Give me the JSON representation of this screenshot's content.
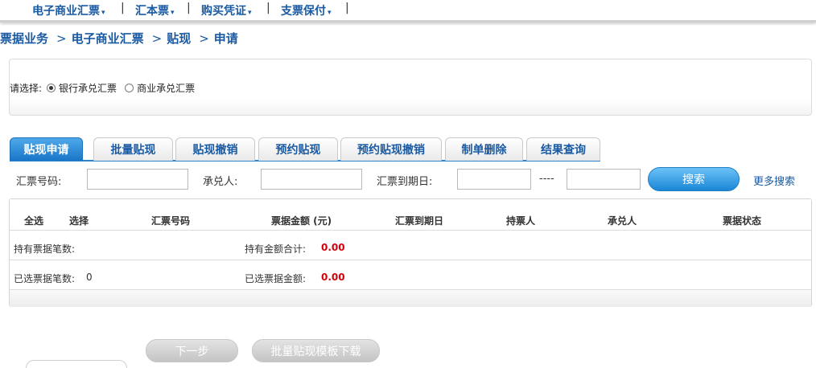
{
  "top_menu": {
    "items": [
      "电子商业汇票",
      "汇本票",
      "购买凭证",
      "支票保付"
    ],
    "separator": "|",
    "caret": "▾"
  },
  "breadcrumb": [
    "票据业务",
    "电子商业汇票",
    "贴现",
    "申请"
  ],
  "breadcrumb_arrow": ">",
  "selection": {
    "prompt": "请选择:",
    "options": [
      "银行承兑汇票",
      "商业承兑汇票"
    ],
    "selected": "银行承兑汇票"
  },
  "tabs": [
    "贴现申请",
    "批量贴现",
    "贴现撤销",
    "预约贴现",
    "预约贴现撤销",
    "制单删除",
    "结果查询"
  ],
  "active_tab": "贴现申请",
  "search": {
    "bill_no_label": "汇票号码:",
    "acceptor_label": "承兑人:",
    "due_date_label": "汇票到期日:",
    "range_sep": "----",
    "search_button": "搜索",
    "more_search": "更多搜索",
    "bill_no_value": "",
    "acceptor_value": "",
    "due_from_value": "",
    "due_to_value": ""
  },
  "table": {
    "headers": [
      "全选",
      "选择",
      "汇票号码",
      "票据金额 (元)",
      "汇票到期日",
      "持票人",
      "承兑人",
      "票据状态"
    ],
    "held_count_label": "持有票据笔数:",
    "held_amount_label": "持有金额合计:",
    "held_amount": "0.00",
    "selected_count_label": "已选票据笔数:",
    "selected_count": "0",
    "selected_amount_label": "已选票据金额:",
    "selected_amount": "0.00"
  },
  "buttons": {
    "next": "下一步",
    "batch_template": "批量贴现模板下载"
  },
  "colors": {
    "brand_blue": "#1a5aa3",
    "tab_active": "#1976c7",
    "amount_red": "#d4000b",
    "disabled_gray": "#c4c4c4"
  }
}
